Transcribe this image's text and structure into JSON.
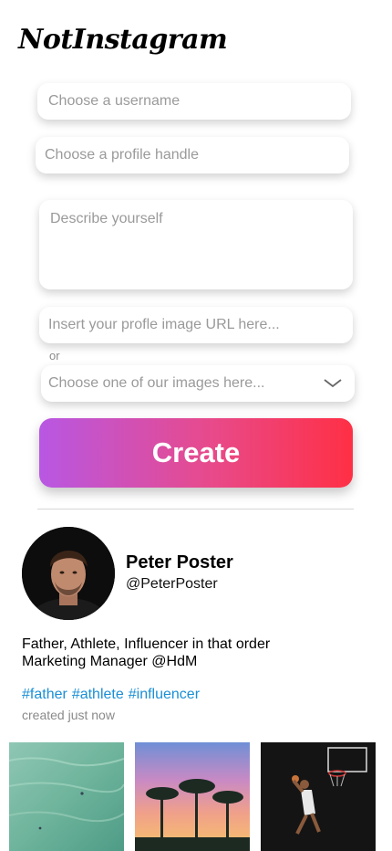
{
  "app": {
    "logo_text": "NotInstagram"
  },
  "form": {
    "username_placeholder": "Choose a username",
    "handle_placeholder": "Choose a profile handle",
    "bio_placeholder": "Describe yourself",
    "image_url_placeholder": "Insert your profle image URL here...",
    "or_label": "or",
    "image_select_placeholder": "Choose one of our images here...",
    "create_label": "Create"
  },
  "profile": {
    "name": "Peter Poster",
    "handle": "@PeterPoster",
    "bio_lines": [
      "Father, Athlete, Influencer in that order",
      "Marketing Manager @HdM"
    ],
    "hashtags": [
      "#father",
      "#athlete",
      "#influencer"
    ],
    "created": "created just now"
  },
  "colors": {
    "gradient_start": "#b857e3",
    "gradient_end": "#ff2f45",
    "hashtag": "#1a8fd6"
  },
  "icons": {
    "select_arrow": "chevron-down-icon"
  }
}
